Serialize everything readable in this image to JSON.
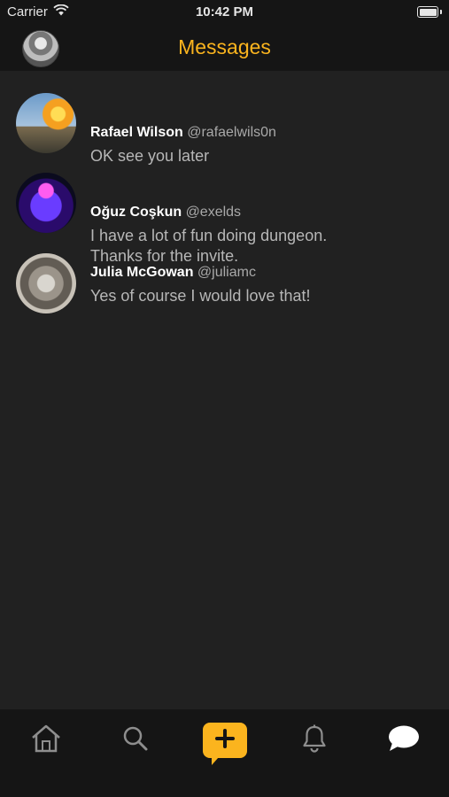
{
  "status_bar": {
    "carrier": "Carrier",
    "time": "10:42 PM"
  },
  "header": {
    "title": "Messages",
    "accent_color": "#fbb41e"
  },
  "messages": [
    {
      "name": "Rafael Wilson",
      "handle": "@rafaelwils0n",
      "lines": [
        "OK see you later"
      ]
    },
    {
      "name": "Oğuz Coşkun",
      "handle": "@exelds",
      "lines": [
        "I have a lot of fun doing dungeon.",
        "Thanks for the invite."
      ]
    },
    {
      "name": "Julia McGowan",
      "handle": "@juliamc",
      "lines": [
        "Yes of course I would love that!"
      ]
    }
  ],
  "tab_bar": {
    "items": [
      {
        "icon": "home-icon"
      },
      {
        "icon": "search-icon"
      },
      {
        "icon": "compose-icon"
      },
      {
        "icon": "bell-icon"
      },
      {
        "icon": "chat-bubble-icon"
      }
    ],
    "active": "chat-bubble-icon"
  }
}
